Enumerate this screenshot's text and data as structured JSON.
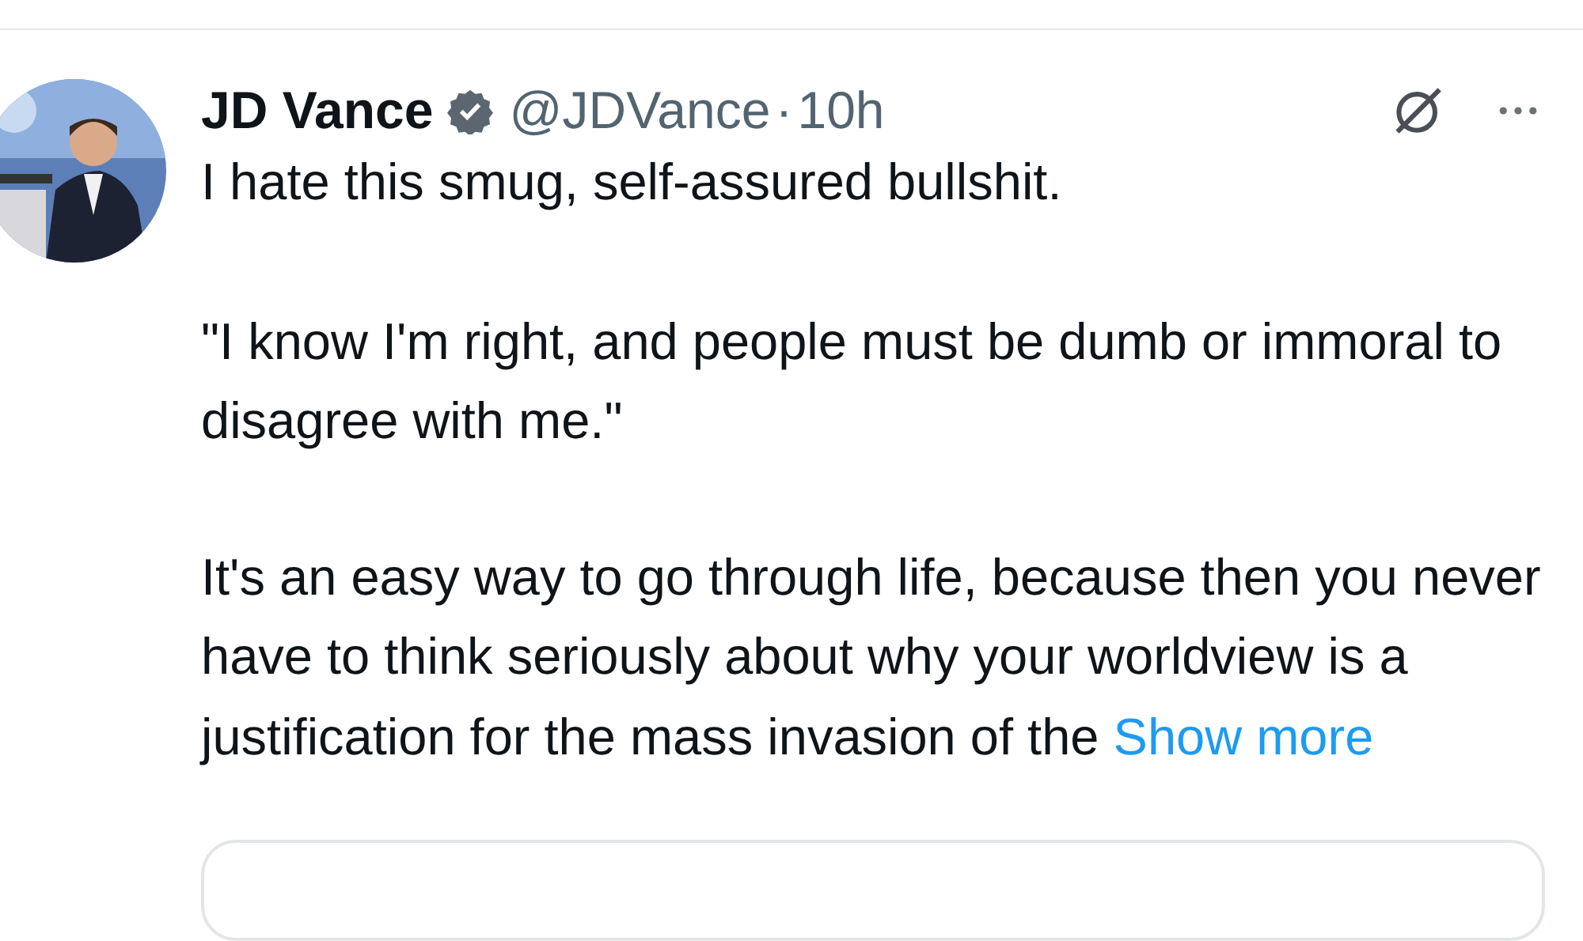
{
  "author": {
    "name": "JD Vance",
    "verified": true,
    "handle": "@JDVance",
    "separator": "·",
    "time": "10h"
  },
  "paragraphs": [
    "I hate this smug, self-assured bullshit.",
    "\"I know I'm right, and people must be dumb or immoral to disagree with me.\"",
    "It's an easy way to go through life, because then you never have to think seriously about why your worldview is a justification for the mass invasion of the"
  ],
  "show_more": "Show more"
}
